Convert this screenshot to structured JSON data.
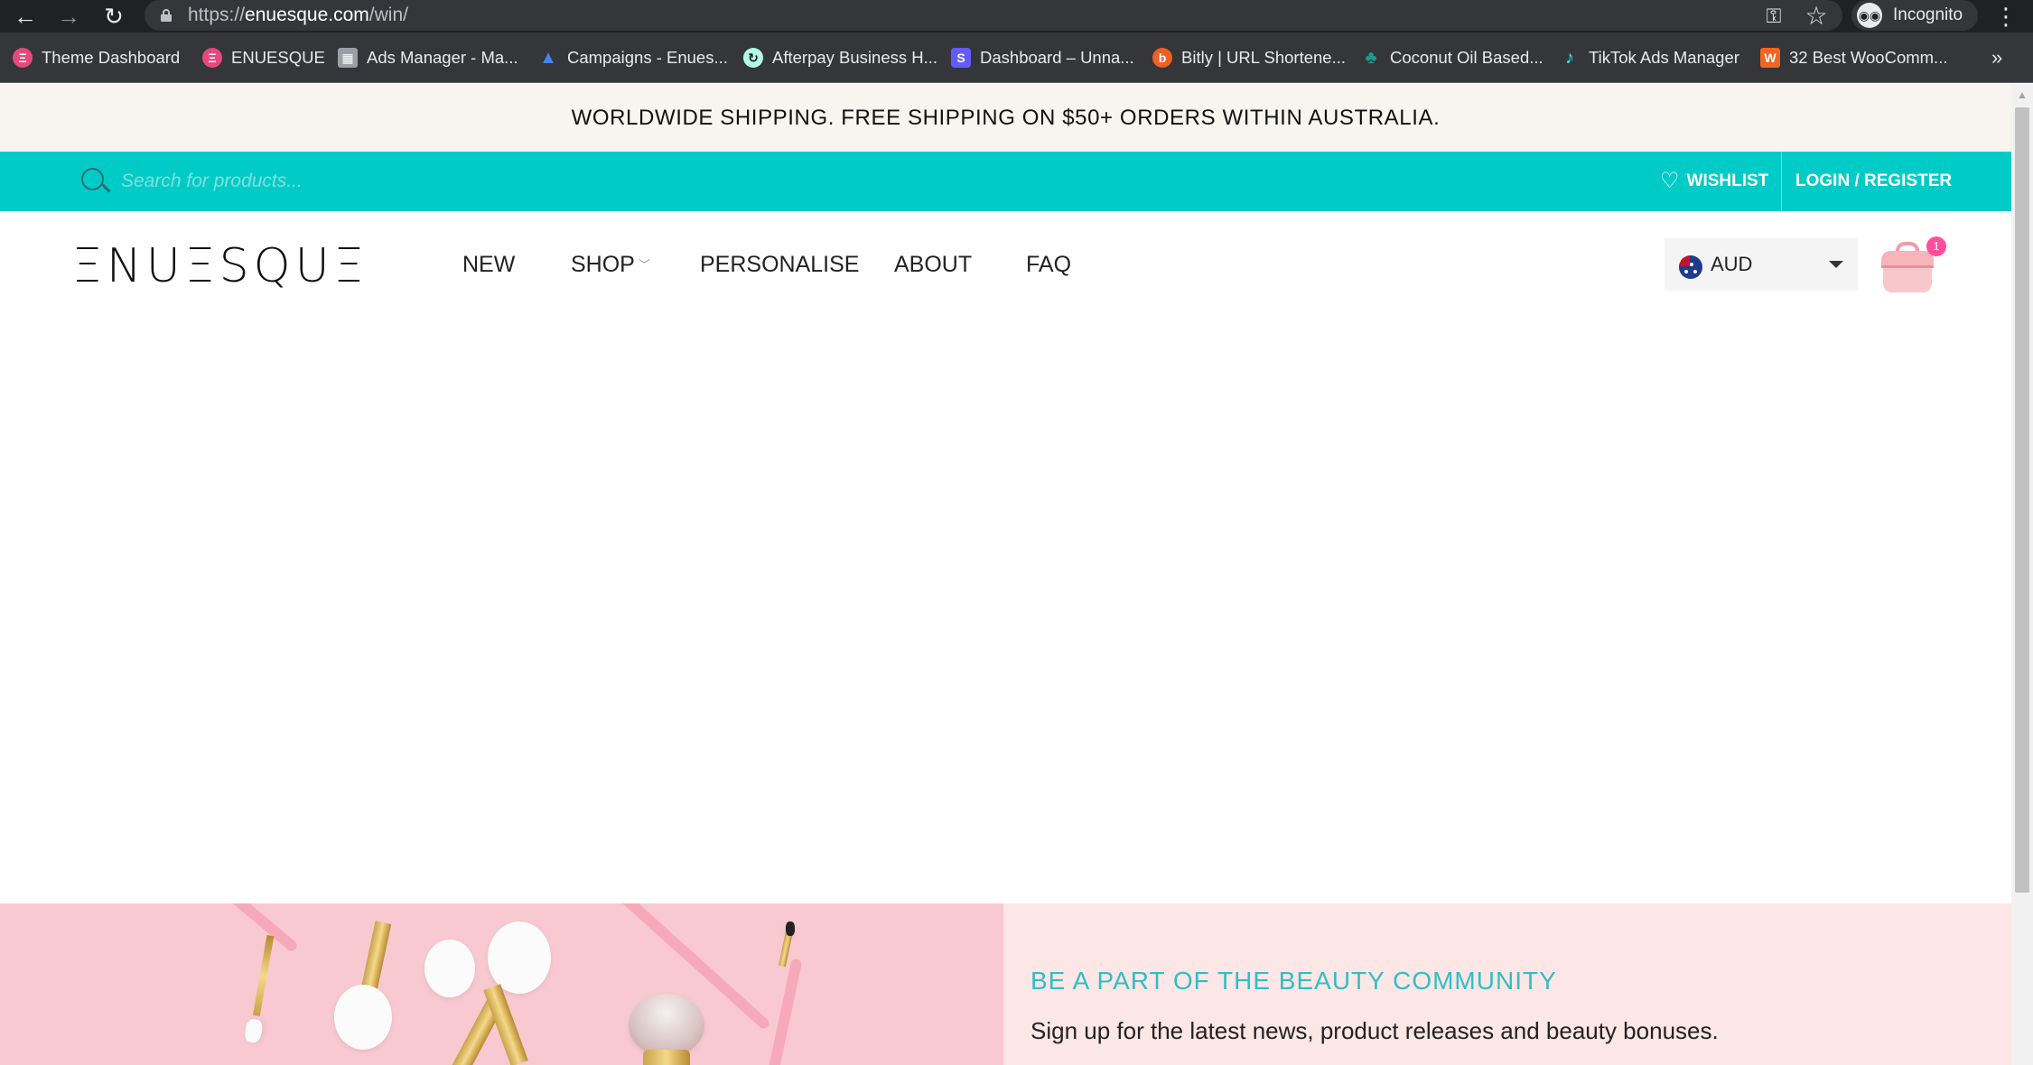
{
  "browser": {
    "url_scheme": "https://",
    "url_host": "enuesque.com",
    "url_path": "/win/",
    "profile_label": "Incognito",
    "more_bookmarks": "»",
    "bookmarks": [
      {
        "label": "Theme Dashboard",
        "icon": "enuesque-icon",
        "color": "#e64a7c"
      },
      {
        "label": "ENUESQUE",
        "icon": "enuesque-icon",
        "color": "#e64a7c"
      },
      {
        "label": "Ads Manager - Ma...",
        "icon": "ads-manager-icon",
        "color": "#9aa0a6"
      },
      {
        "label": "Campaigns - Enues...",
        "icon": "google-ads-icon",
        "color": "#4285f4"
      },
      {
        "label": "Afterpay Business H...",
        "icon": "afterpay-icon",
        "color": "#b2fce4"
      },
      {
        "label": "Dashboard – Unna...",
        "icon": "stripe-icon",
        "color": "#635bff"
      },
      {
        "label": "Bitly | URL Shortene...",
        "icon": "bitly-icon",
        "color": "#ee6123"
      },
      {
        "label": "Coconut Oil Based...",
        "icon": "palm-tree-icon",
        "color": "#1a9e8c"
      },
      {
        "label": "TikTok Ads Manager",
        "icon": "tiktok-icon",
        "color": "#25f4ee"
      },
      {
        "label": "32 Best WooComm...",
        "icon": "woocommerce-icon",
        "color": "#f26522"
      }
    ]
  },
  "site": {
    "announcement": "WORLDWIDE SHIPPING. FREE SHIPPING ON $50+ ORDERS WITHIN AUSTRALIA.",
    "search": {
      "placeholder": "Search for products..."
    },
    "wishlist_label": "WISHLIST",
    "login_label": "LOGIN / REGISTER",
    "logo_text": "ΞNUΞSQUΞ",
    "nav": {
      "new": "NEW",
      "shop": "SHOP",
      "personalise": "PERSONALISE",
      "about": "ABOUT",
      "faq": "FAQ"
    },
    "currency": "AUD",
    "cart_count": "1",
    "colors": {
      "teal": "#00cbc7",
      "pink": "#f9c9d1",
      "badge": "#ff4f9a",
      "accent_text": "#2fbfc4"
    }
  },
  "newsletter": {
    "title": "BE A PART OF THE BEAUTY COMMUNITY",
    "subtitle": "Sign up for the latest news, product releases and beauty bonuses."
  }
}
